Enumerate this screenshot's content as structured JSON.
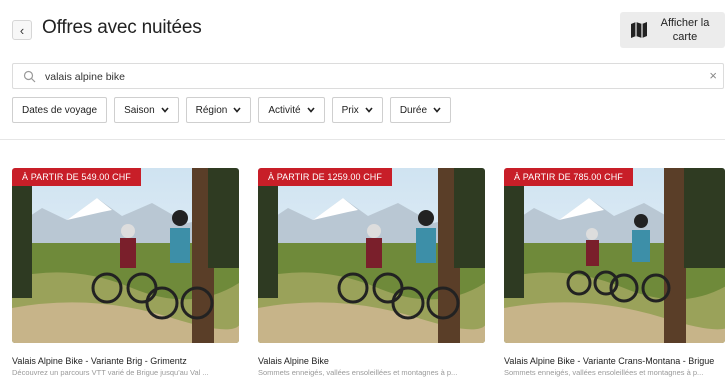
{
  "header": {
    "back_icon": "chevron-left-icon",
    "title": "Offres avec nuitées",
    "map_button": {
      "icon": "map-icon",
      "line1": "Afficher la",
      "line2": "carte"
    }
  },
  "search": {
    "value": "valais alpine bike",
    "icon": "search-icon",
    "clear_icon": "close-icon"
  },
  "filters": [
    {
      "label": "Dates de voyage",
      "dropdown": false
    },
    {
      "label": "Saison",
      "dropdown": true
    },
    {
      "label": "Région",
      "dropdown": true
    },
    {
      "label": "Activité",
      "dropdown": true
    },
    {
      "label": "Prix",
      "dropdown": true
    },
    {
      "label": "Durée",
      "dropdown": true
    }
  ],
  "cards": [
    {
      "price": "À PARTIR DE 549.00 CHF",
      "title": "Valais Alpine Bike - Variante Brig - Grimentz",
      "description": "Découvrez un parcours VTT varié de Brigue jusqu'au Val ..."
    },
    {
      "price": "À PARTIR DE 1259.00 CHF",
      "title": "Valais Alpine Bike",
      "description": "Sommets enneigés, vallées ensoleillées et montagnes à p..."
    },
    {
      "price": "À PARTIR DE 785.00 CHF",
      "title": "Valais Alpine Bike - Variante Crans-Montana - Brigue",
      "description": "Sommets enneigés, vallées ensoleillées et montagnes à p..."
    }
  ],
  "colors": {
    "badge": "#c81e28",
    "map_button_bg": "#ececec"
  }
}
